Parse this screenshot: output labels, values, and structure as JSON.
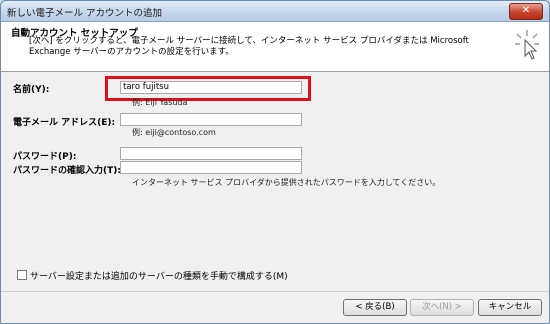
{
  "window": {
    "title": "新しい電子メール アカウントの追加",
    "close_symbol": "✕"
  },
  "header": {
    "title": "自動アカウント セットアップ",
    "description": "[次へ] をクリックすると、電子メール サーバーに接続して、インターネット サービス プロバイダまたは Microsoft Exchange サーバーのアカウントの設定を行います。",
    "icon": "cursor-click-icon"
  },
  "form": {
    "name": {
      "label": "名前(Y):",
      "value": "taro fujitsu",
      "hint": "例: Eiji Yasuda"
    },
    "email": {
      "label": "電子メール アドレス(E):",
      "value": "",
      "hint": "例: eiji@contoso.com"
    },
    "password": {
      "label": "パスワード(P):",
      "value": ""
    },
    "password_confirm": {
      "label": "パスワードの確認入力(T):",
      "value": "",
      "hint": "インターネット サービス プロバイダから提供されたパスワードを入力してください。"
    }
  },
  "manual_config": {
    "label": "サーバー設定または追加のサーバーの種類を手動で構成する(M)",
    "checked": false
  },
  "buttons": {
    "back": "< 戻る(B)",
    "next": "次へ(N) >",
    "cancel": "キャンセル"
  },
  "colors": {
    "highlight": "#e0101a"
  }
}
